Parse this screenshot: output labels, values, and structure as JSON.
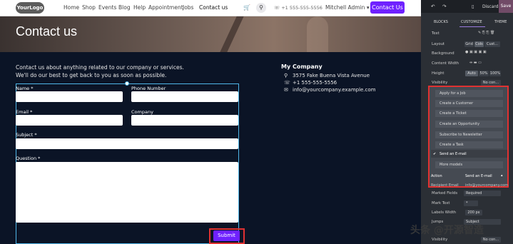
{
  "nav": {
    "logo": "YourLogo",
    "links": [
      "Home",
      "Shop",
      "Events",
      "Blog",
      "Help",
      "Appointment",
      "Jobs",
      "Contact us"
    ],
    "phone": "+1 555-555-5556",
    "user": "Mitchell Admin",
    "cta": "Contact Us"
  },
  "banner": {
    "title": "Contact us"
  },
  "intro": {
    "line1": "Contact us about anything related to our company or services.",
    "line2": "We'll do our best to get back to you as soon as possible."
  },
  "form": {
    "name_label": "Name *",
    "phone_label": "Phone Number",
    "email_label": "Email *",
    "company_label": "Company",
    "subject_label": "Subject *",
    "question_label": "Question *",
    "submit_label": "Submit"
  },
  "company": {
    "title": "My Company",
    "address": "3575 Fake Buena Vista Avenue",
    "phone": "+1 555-555-5556",
    "email": "info@yourcompany.example.com"
  },
  "panel": {
    "discard": "Discard",
    "save": "Save",
    "tabs": [
      "BLOCKS",
      "CUSTOMIZE",
      "THEME"
    ],
    "section": "Text",
    "layout_label": "Layout",
    "layout_options": [
      "Grid",
      "Cols",
      "Cust..."
    ],
    "background_label": "Background",
    "content_width_label": "Content Width",
    "height_label": "Height",
    "height_options": [
      "Auto",
      "50%",
      "100%"
    ],
    "visibility_label": "Visibility",
    "visibility_value": "No con...",
    "dropdown_items": [
      "Apply for a Job",
      "Create a Customer",
      "Create a Ticket",
      "Create an Opportunity",
      "Subscribe to Newsletter",
      "Create a Task",
      "Send an E-mail",
      "More models"
    ],
    "action_label": "Action",
    "action_value": "Send an E-mail",
    "recipient_label": "Recipient Email",
    "recipient_value": "info@yourcompany.com",
    "marked_fields_label": "Marked Fields",
    "marked_fields_value": "Required",
    "mark_text_label": "Mark Text",
    "mark_text_value": "*",
    "labels_width_label": "Labels Width",
    "labels_width_value": "200",
    "labels_width_unit": "px",
    "field_label": "Jumps",
    "field_value": "Subject",
    "visibility2_label": "Visibility",
    "visibility2_value": "No con..."
  },
  "watermark": "头条 @开源智造"
}
